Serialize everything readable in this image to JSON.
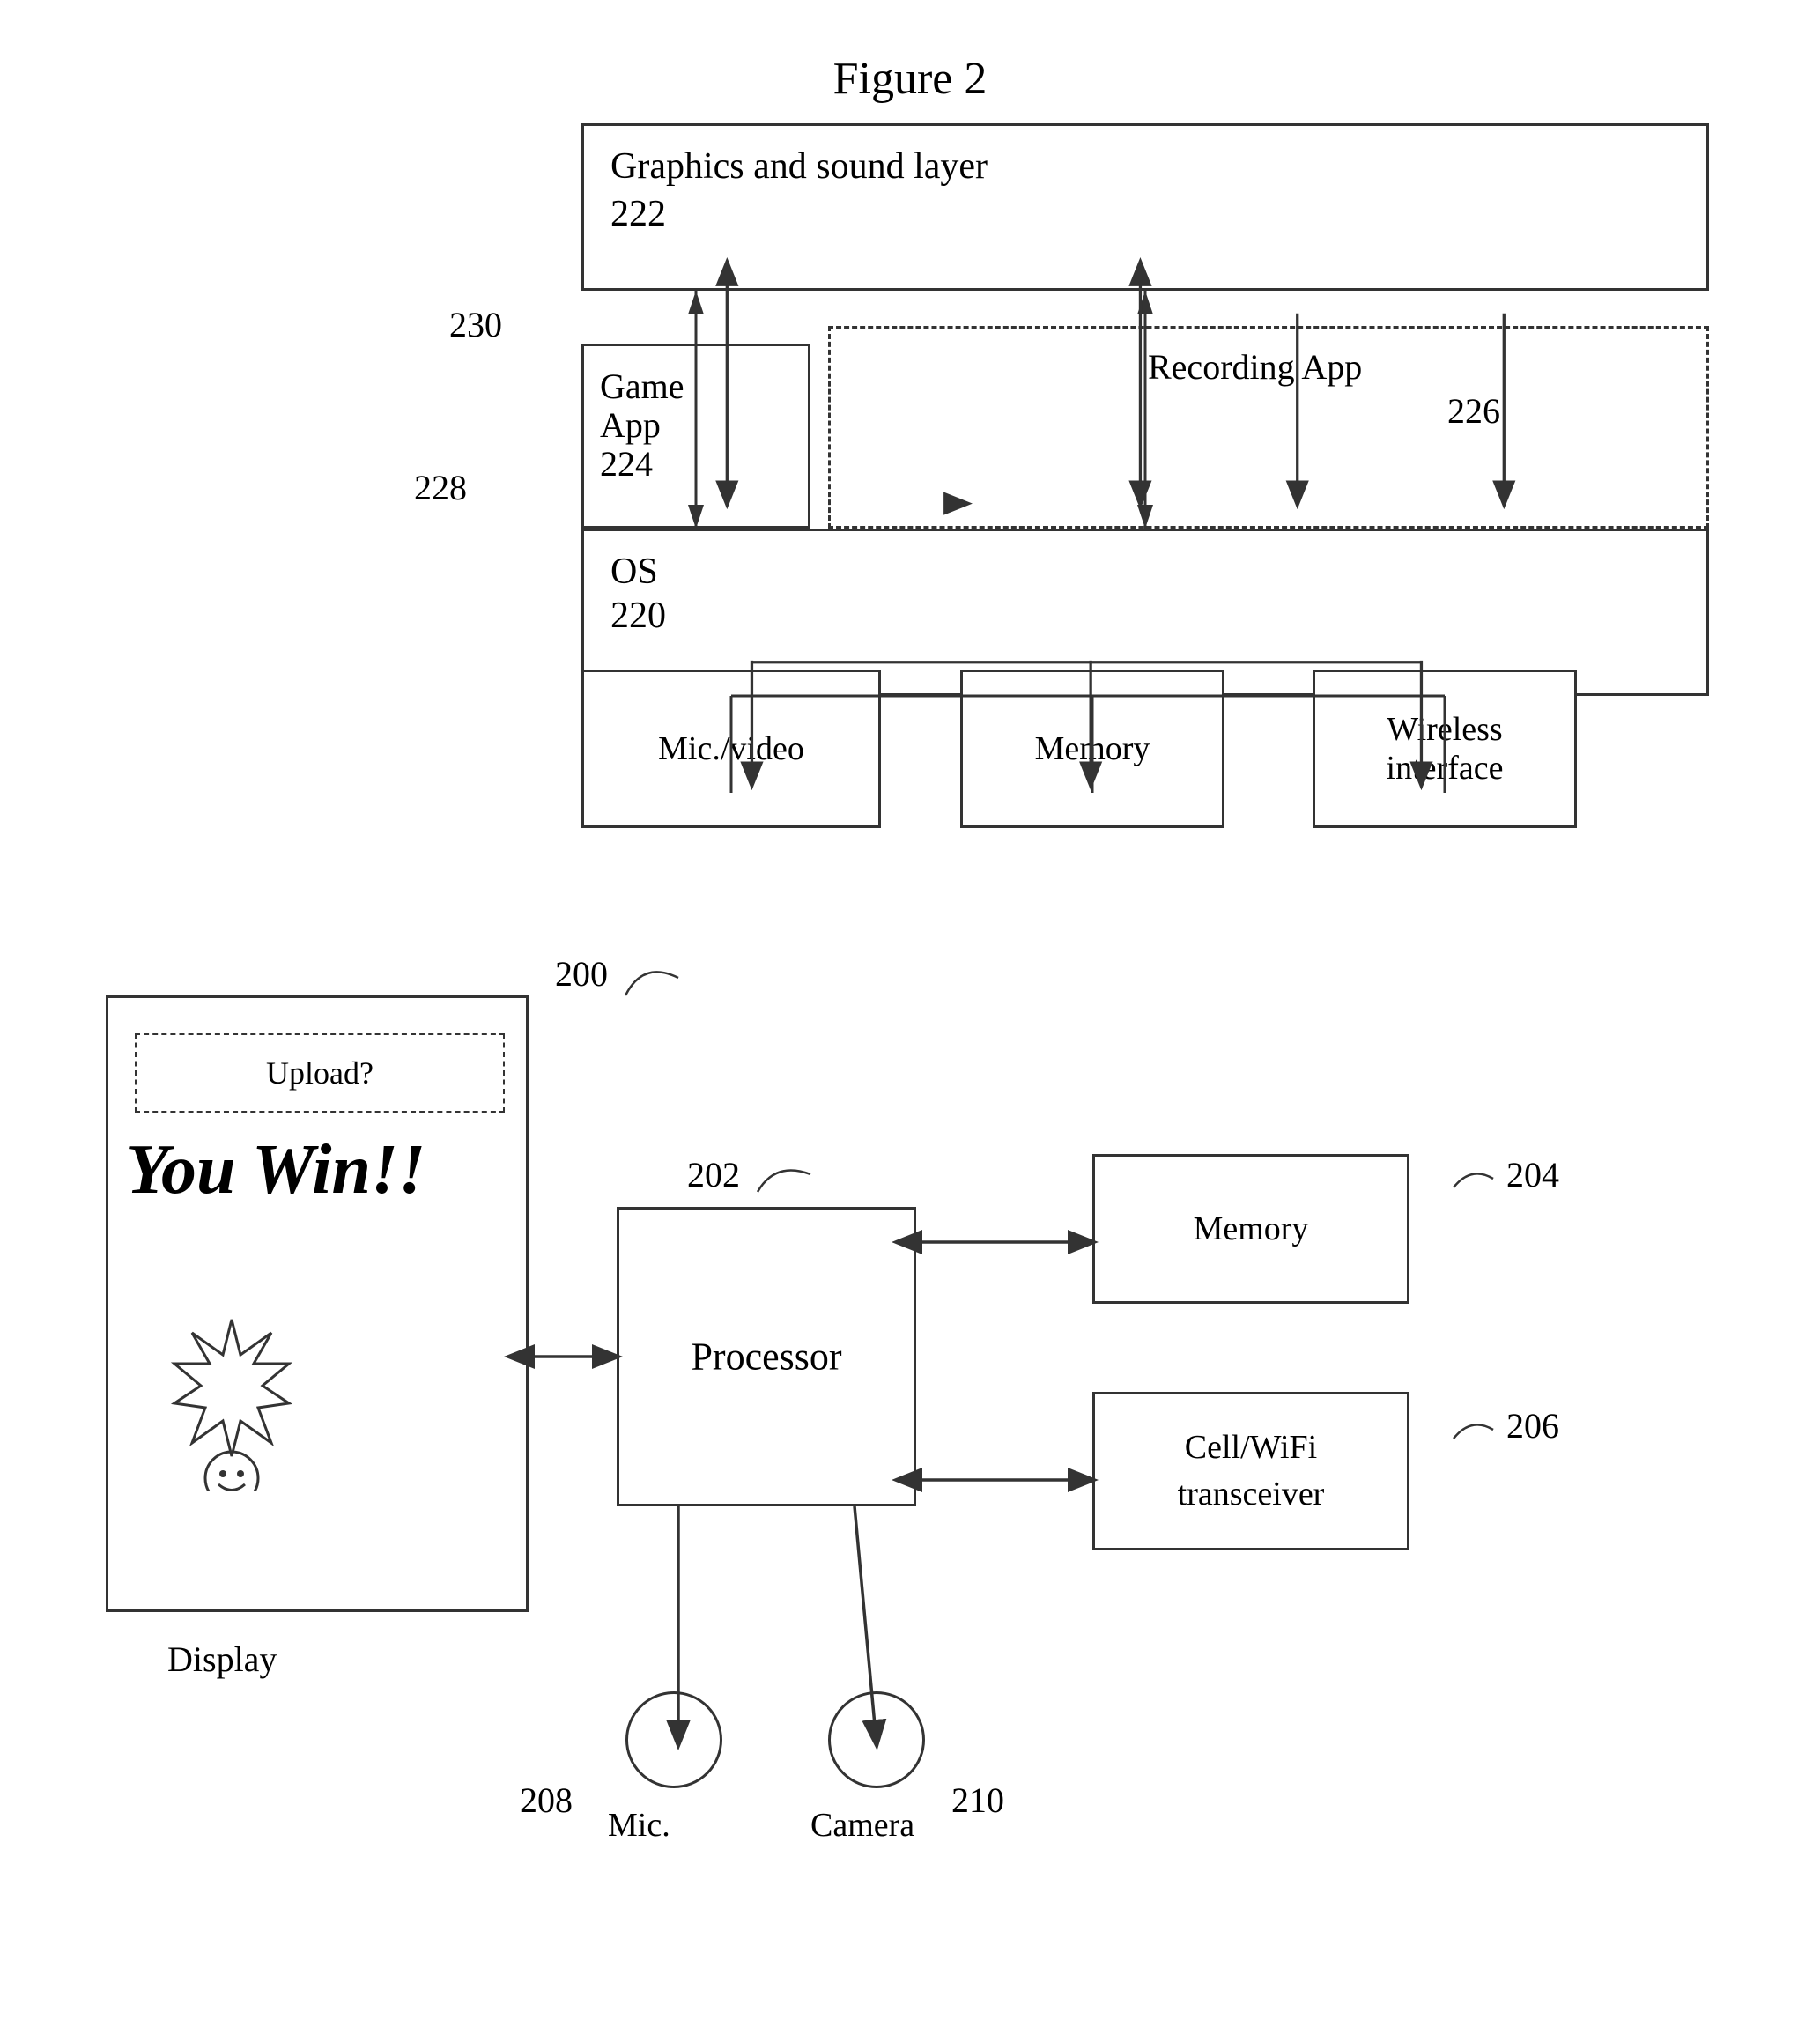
{
  "title": "Figure 2",
  "top_diagram": {
    "graphics_label": "Graphics and sound layer",
    "graphics_num": "222",
    "label_230": "230",
    "game_label1": "Game",
    "game_label2": "App",
    "game_num": "224",
    "recording_label": "Recording App",
    "recording_num": "226",
    "label_228": "228",
    "os_label": "OS",
    "os_num": "220",
    "mic_label": "Mic./video",
    "memory_top_label": "Memory",
    "wireless_label": "Wireless\ninterface"
  },
  "bottom_diagram": {
    "upload_label": "Upload?",
    "you_win_label": "You Win!!",
    "display_label": "Display",
    "label_200": "200",
    "label_202": "202",
    "processor_label": "Processor",
    "memory_bottom_label": "Memory",
    "label_204": "204",
    "cell_label1": "Cell/WiFi",
    "cell_label2": "transceiver",
    "label_206": "206",
    "mic_label": "Mic.",
    "label_208": "208",
    "camera_label": "Camera",
    "label_210": "210"
  }
}
